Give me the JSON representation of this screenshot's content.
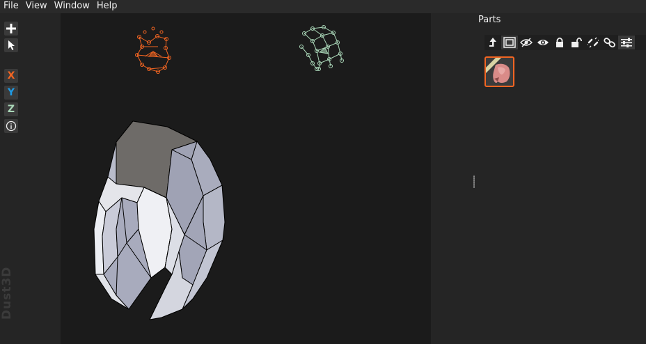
{
  "menu": {
    "file": "File",
    "view": "View",
    "window": "Window",
    "help": "Help"
  },
  "toolbar": {
    "add": "+",
    "x_axis": "X",
    "y_axis": "Y",
    "z_axis": "Z",
    "info": "i",
    "x_color": "#f26522",
    "y_color": "#1e9be6",
    "z_color": "#aad7b8"
  },
  "watermark": "Dust3D",
  "parts_panel": {
    "title": "Parts",
    "tools": [
      "up-arrow-icon",
      "select-part-icon",
      "hide-icon",
      "show-icon",
      "lock-icon",
      "unlock-icon",
      "unlink-icon",
      "link-icon",
      "settings-icon"
    ],
    "selected_color": "#f26522"
  },
  "colors": {
    "front_view": "#f26522",
    "side_view": "#aad7b8",
    "mesh": "#c8cad6",
    "mesh_top": "#6e6b68",
    "viewport_bg": "#1b1b1b"
  }
}
